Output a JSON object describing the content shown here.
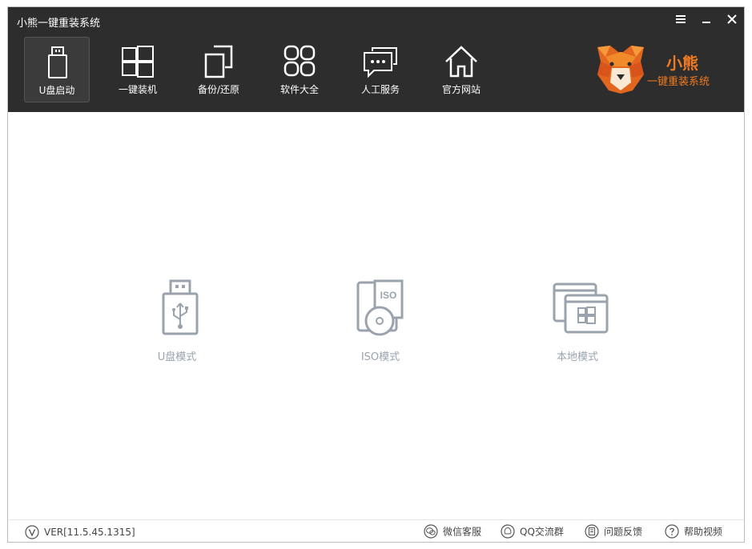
{
  "window": {
    "title": "小熊一键重装系统"
  },
  "nav": {
    "items": [
      {
        "label": "U盘启动",
        "icon": "usb-drive-icon"
      },
      {
        "label": "一键装机",
        "icon": "windows-icon"
      },
      {
        "label": "备份/还原",
        "icon": "backup-icon"
      },
      {
        "label": "软件大全",
        "icon": "apps-grid-icon"
      },
      {
        "label": "人工服务",
        "icon": "chat-bubbles-icon"
      },
      {
        "label": "官方网站",
        "icon": "home-icon"
      }
    ],
    "active_index": 0
  },
  "brand": {
    "name": "小熊",
    "slogan": "一键重装系统",
    "color": "#f07a22"
  },
  "modes": [
    {
      "label": "U盘模式",
      "icon": "usb-drive-icon"
    },
    {
      "label": "ISO模式",
      "icon": "iso-disc-icon",
      "icon_text": "ISO"
    },
    {
      "label": "本地模式",
      "icon": "local-windows-icon"
    }
  ],
  "footer": {
    "version": "VER[11.5.45.1315]",
    "links": [
      {
        "label": "微信客服",
        "icon": "wechat-icon"
      },
      {
        "label": "QQ交流群",
        "icon": "qq-icon"
      },
      {
        "label": "问题反馈",
        "icon": "feedback-icon"
      },
      {
        "label": "帮助视频",
        "icon": "help-icon"
      }
    ]
  },
  "colors": {
    "header_bg": "#2d2d2d",
    "mode_icon": "#9aa3ad",
    "accent": "#f07a22"
  }
}
